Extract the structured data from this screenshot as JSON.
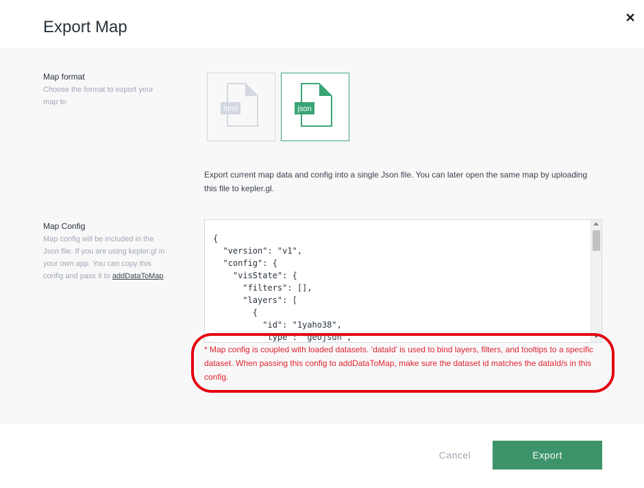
{
  "modal": {
    "title": "Export Map",
    "close_icon": "close-icon"
  },
  "map_format": {
    "title": "Map format",
    "description": "Choose the format to export your map to",
    "options": [
      {
        "label": "html",
        "icon": "file-icon",
        "selected": false
      },
      {
        "label": "json",
        "icon": "file-icon",
        "selected": true
      }
    ],
    "format_description": "Export current map data and config into a single Json file. You can later open the same map by uploading this file to kepler.gl."
  },
  "map_config": {
    "title": "Map Config",
    "description_before_link": "Map config will be included in the Json file. If you are using kepler.gl in your own app. You can copy this config and pass it to ",
    "description_link": "addDataToMap",
    "description_after_link": ".",
    "config_text": "{\n  \"version\": \"v1\",\n  \"config\": {\n    \"visState\": {\n      \"filters\": [],\n      \"layers\": [\n        {\n          \"id\": \"1yaho38\",\n          \"type\": \"geojson\",",
    "warning": "* Map config is coupled with loaded datasets. ‘dataId’ is used to bind layers, filters, and tooltips to a specific dataset. When passing this config to addDataToMap, make sure the dataset id matches the dataId/s in this config."
  },
  "footer": {
    "cancel_label": "Cancel",
    "export_label": "Export"
  },
  "colors": {
    "accent": "#3d946a",
    "selected_border": "#3ba474",
    "warning_text": "#e0232e",
    "highlight_ring": "#e4000f"
  }
}
